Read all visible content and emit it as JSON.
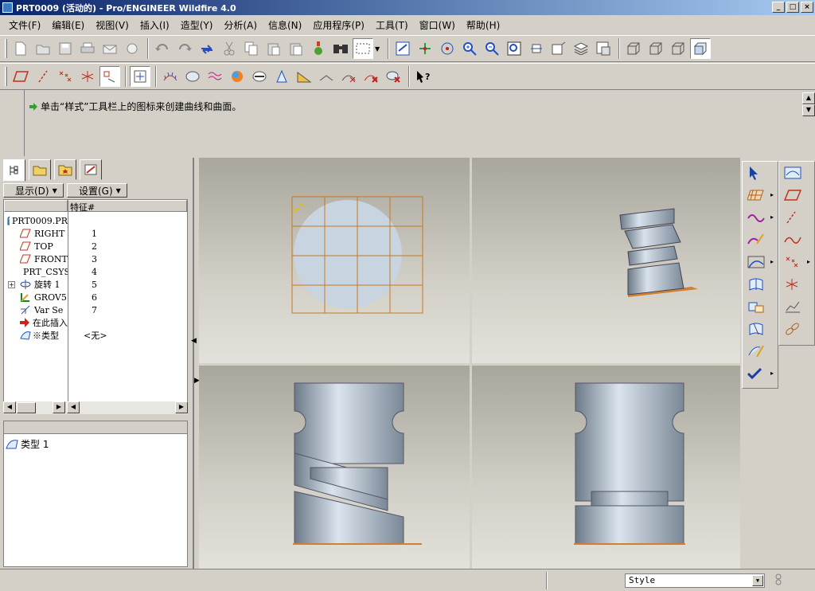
{
  "window": {
    "title": "PRT0009 (活动的) - Pro/ENGINEER Wildfire 4.0",
    "controls": [
      "_",
      "□",
      "×"
    ]
  },
  "menu": [
    "文件(F)",
    "编辑(E)",
    "视图(V)",
    "插入(I)",
    "造型(Y)",
    "分析(A)",
    "信息(N)",
    "应用程序(P)",
    "工具(T)",
    "窗口(W)",
    "帮助(H)"
  ],
  "message": {
    "text": "单击“样式”工具栏上的图标来创建曲线和曲面。"
  },
  "model_tree": {
    "display_label": "显示(D)",
    "settings_label": "设置(G)",
    "column_header": "特征#",
    "items": [
      {
        "name": "PRT0009.PR",
        "num": ""
      },
      {
        "name": "RIGHT",
        "num": "1"
      },
      {
        "name": "TOP",
        "num": "2"
      },
      {
        "name": "FRONT",
        "num": "3"
      },
      {
        "name": "PRT_CSYS",
        "num": "4"
      },
      {
        "name": "旋转 1",
        "num": "5"
      },
      {
        "name": "GROV5",
        "num": "6"
      },
      {
        "name": "Var Se",
        "num": "7"
      },
      {
        "name": "在此插入",
        "num": ""
      },
      {
        "name": "※类型",
        "num": "<无>"
      }
    ]
  },
  "layer_panel": {
    "item": "类型 1"
  },
  "status": {
    "filter_value": "Style"
  },
  "colors": {
    "titlebar": "#0a246a",
    "grid": "#c8781e",
    "model": "#9aa8b6"
  }
}
